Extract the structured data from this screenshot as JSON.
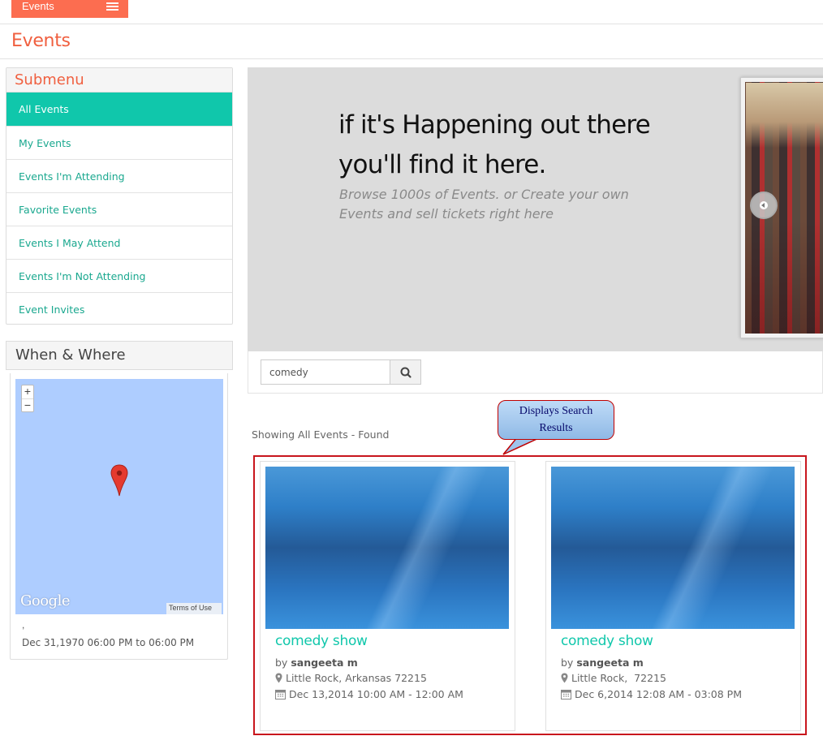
{
  "top_tab": {
    "label": "Events"
  },
  "page": {
    "title": "Events"
  },
  "submenu": {
    "title": "Submenu",
    "items": [
      {
        "label": "All Events",
        "active": true
      },
      {
        "label": "My Events"
      },
      {
        "label": "Events I'm Attending"
      },
      {
        "label": "Favorite Events"
      },
      {
        "label": "Events I May Attend"
      },
      {
        "label": "Events I'm Not Attending"
      },
      {
        "label": "Event Invites"
      }
    ]
  },
  "when_where": {
    "title": "When & Where",
    "map": {
      "zoom_in": "+",
      "zoom_out": "−",
      "brand": "Google",
      "terms": "Terms of Use"
    },
    "location": ",",
    "date": "Dec 31,1970 06:00 PM to 06:00 PM"
  },
  "banner": {
    "headline_1": "if it's Happening out there",
    "headline_2": "you'll find it here.",
    "sub_1": "Browse 1000s of Events. or Create your own",
    "sub_2": "Events and sell tickets right here"
  },
  "search": {
    "value": "comedy",
    "placeholder": ""
  },
  "callout": {
    "line_1": "Displays Search",
    "line_2": "Results"
  },
  "results": {
    "summary": "Showing All Events - Found",
    "cards": [
      {
        "title": "comedy show",
        "by": "by",
        "organizer": "sangeeta m",
        "location": "Little Rock, Arkansas 72215",
        "date": "Dec 13,2014 10:00 AM - 12:00 AM"
      },
      {
        "title": "comedy show",
        "by": "by",
        "organizer": "sangeeta m",
        "location": "Little Rock,  72215",
        "date": "Dec 6,2014 12:08 AM - 03:08 PM"
      }
    ]
  },
  "colors": {
    "accent": "#10c7ab",
    "brand": "#fc6d50",
    "title": "#f05f3f",
    "highlight_box": "#c8161d"
  }
}
